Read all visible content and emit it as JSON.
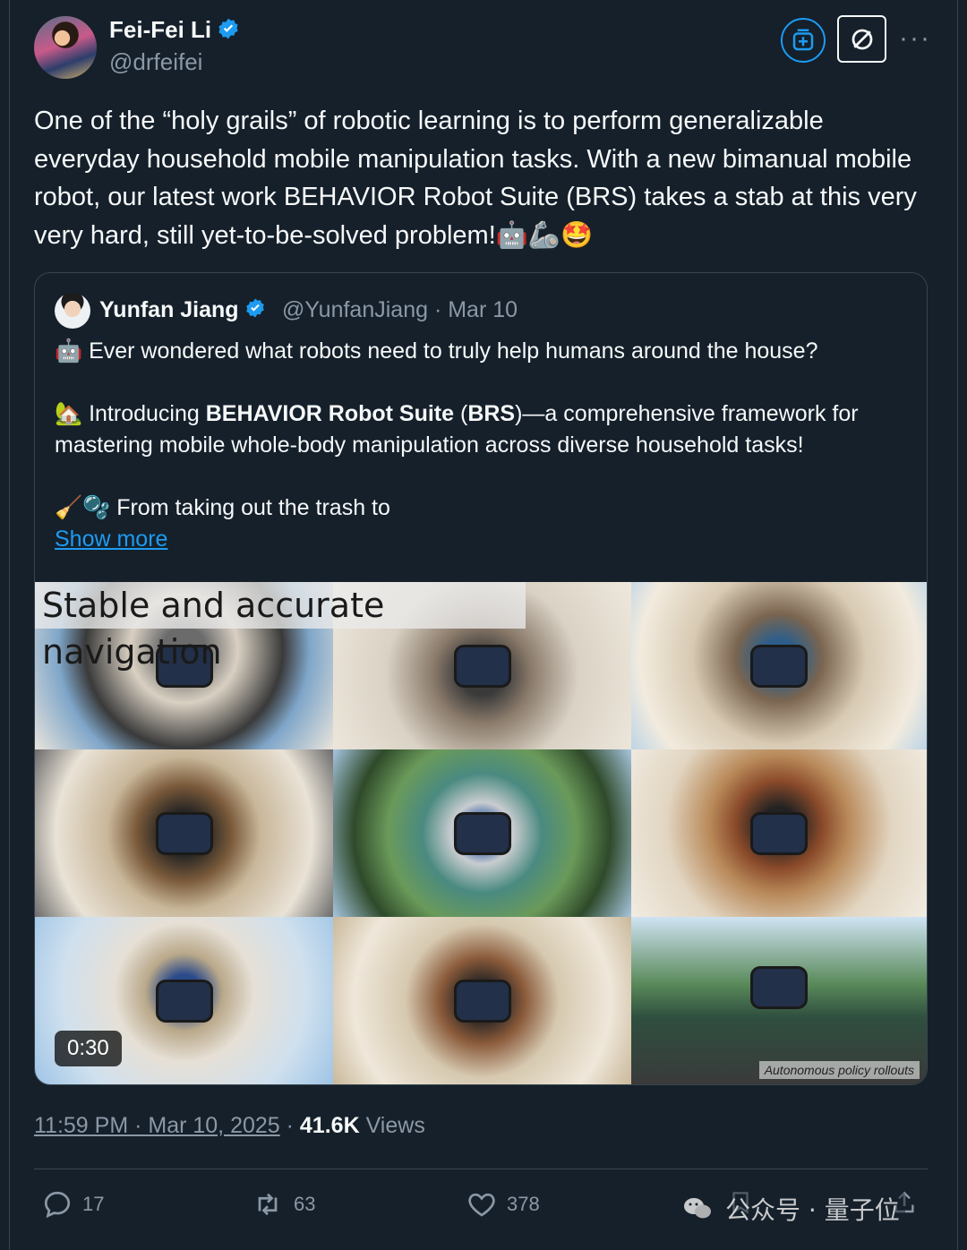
{
  "author": {
    "name": "Fei-Fei Li",
    "handle": "@drfeifei"
  },
  "header_actions": {
    "subscribe_icon": "add-to-list-icon",
    "block_icon": "block-icon",
    "more_label": "···"
  },
  "tweet": {
    "text": "One of the “holy grails” of robotic learning is to perform generalizable everyday household mobile manipulation tasks. With a new bimanual mobile robot, our latest work BEHAVIOR Robot Suite (BRS) takes a stab at this very very hard, still yet-to-be-solved problem!🤖🦾🤩"
  },
  "quoted": {
    "name": "Yunfan Jiang",
    "meta": "@YunfanJiang · Mar 10",
    "line1": "🤖 Ever wondered what robots need to truly help humans around the house?",
    "line2_prefix": "🏡 Introducing ",
    "line2_bold": "BEHAVIOR Robot Suite",
    "line2_mid": " (",
    "line2_bold2": "BRS",
    "line2_suffix": ")—a comprehensive framework for mastering mobile whole-body manipulation across diverse household tasks!",
    "line3": "🧹🫧 From taking out the trash to",
    "show_more": "Show more",
    "video": {
      "title_overlay": "Stable and accurate navigation",
      "duration": "0:30",
      "caption": "Autonomous policy rollouts"
    }
  },
  "meta": {
    "timestamp": "11:59 PM · Mar 10, 2025",
    "separator": " · ",
    "views_count": "41.6K",
    "views_label": "Views"
  },
  "actions": {
    "replies": "17",
    "retweets": "63",
    "likes": "378"
  },
  "watermark": {
    "text": "公众号 · 量子位"
  },
  "colors": {
    "background": "#15202b",
    "accent": "#1d9bf0",
    "secondary_text": "#8b98a5",
    "border": "#38444d"
  }
}
